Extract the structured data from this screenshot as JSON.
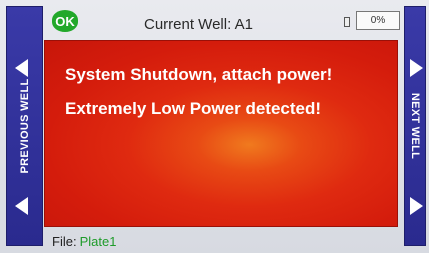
{
  "colors": {
    "side_panel": "#2f2f9c",
    "alert_background": "#d8200e",
    "ok_badge": "#22a82a",
    "file_value": "#1e9b2a"
  },
  "status_badge": {
    "label": "OK"
  },
  "header": {
    "title": "Current Well: A1",
    "battery_percent": "0%",
    "battery_icon": "battery-icon"
  },
  "left_panel": {
    "label": "PREVIOUS WELL",
    "up_icon": "arrow-left-icon",
    "down_icon": "arrow-left-icon"
  },
  "right_panel": {
    "label": "NEXT WELL",
    "up_icon": "arrow-right-icon",
    "down_icon": "arrow-right-icon"
  },
  "alert": {
    "line1": "System Shutdown, attach power!",
    "line2": "Extremely Low Power detected!"
  },
  "footer": {
    "file_label": "File:",
    "file_value": "Plate1"
  }
}
